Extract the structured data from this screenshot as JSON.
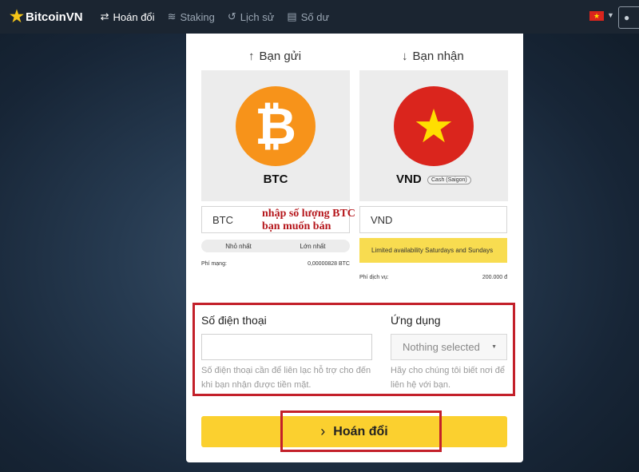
{
  "nav": {
    "brand": "BitcoinVN",
    "items": [
      {
        "label": "Hoán đổi",
        "icon": "swap-icon"
      },
      {
        "label": "Staking",
        "icon": "coins-icon"
      },
      {
        "label": "Lịch sử",
        "icon": "history-icon"
      },
      {
        "label": "Số dư",
        "icon": "wallet-icon"
      }
    ],
    "language_flag": "vietnam-flag-icon"
  },
  "send": {
    "heading": "Bạn gửi",
    "coin": "BTC",
    "amount_placeholder": "BTC",
    "min_label": "Nhỏ nhất",
    "max_label": "Lớn nhất",
    "fee_label": "Phí mạng:",
    "fee_value": "0,00000828 BTC"
  },
  "receive": {
    "heading": "Bạn nhận",
    "coin": "VND",
    "badge": "Cash (Saigon)",
    "amount_placeholder": "VND",
    "notice": "Limited availability Saturdays and Sundays",
    "fee_label": "Phí dịch vụ:",
    "fee_value": "200.000 đ"
  },
  "annotation": {
    "line1": "nhập số lượng BTC",
    "line2": "bạn muốn bán"
  },
  "contact": {
    "phone_label": "Số điện thoại",
    "phone_help": "Số điện thoại cần để liên lạc hỗ trợ cho đến khi bạn nhận được tiền mặt.",
    "app_label": "Ứng dụng",
    "app_selected": "Nothing selected",
    "app_help": "Hãy cho chúng tôi biết nơi để liên hệ với bạn."
  },
  "action": {
    "swap_label": "Hoán đổi"
  },
  "colors": {
    "accent_yellow": "#fbd02f",
    "btc_orange": "#f7931a",
    "vn_red": "#da251d",
    "highlight_red": "#c3202a"
  }
}
